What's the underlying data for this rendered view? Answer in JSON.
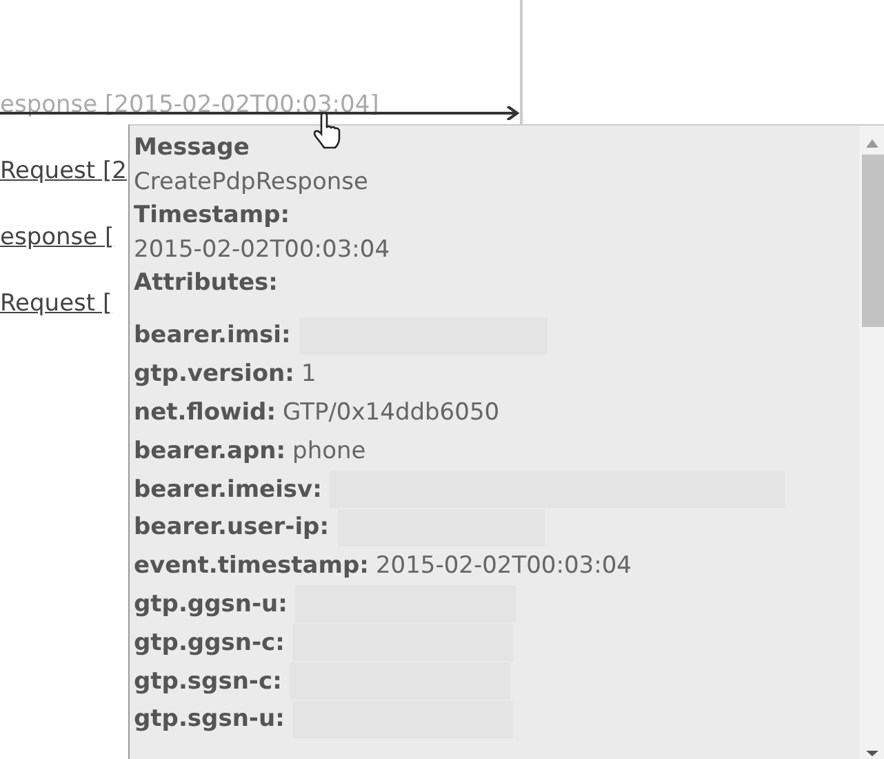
{
  "links": [
    {
      "text": "esponse [2015-02-02T00:03:04]",
      "dimmed": true
    },
    {
      "text": "Request [2",
      "dimmed": false
    },
    {
      "text": "esponse [",
      "dimmed": false
    },
    {
      "text": "Request [",
      "dimmed": false
    }
  ],
  "tooltip": {
    "message_label": "Message",
    "message": "CreatePdpResponse",
    "timestamp_label": "Timestamp:",
    "timestamp": "2015-02-02T00:03:04",
    "attributes_label": "Attributes:",
    "attributes": [
      {
        "key": "bearer.imsi:",
        "redacted": true
      },
      {
        "key": "gtp.version:",
        "value": "1",
        "redacted": false
      },
      {
        "key": "net.flowid:",
        "value": "GTP/0x14ddb6050",
        "redacted": false
      },
      {
        "key": "bearer.apn:",
        "value": "phone",
        "redacted": false
      },
      {
        "key": "bearer.imeisv:",
        "redacted": true
      },
      {
        "key": "bearer.user-ip:",
        "redacted": true
      },
      {
        "key": "event.timestamp:",
        "value": "2015-02-02T00:03:04",
        "redacted": false
      },
      {
        "key": "gtp.ggsn-u:",
        "redacted": true
      },
      {
        "key": "gtp.ggsn-c:",
        "redacted": true
      },
      {
        "key": "gtp.sgsn-c:",
        "redacted": true
      },
      {
        "key": "gtp.sgsn-u:",
        "redacted": true
      }
    ]
  }
}
